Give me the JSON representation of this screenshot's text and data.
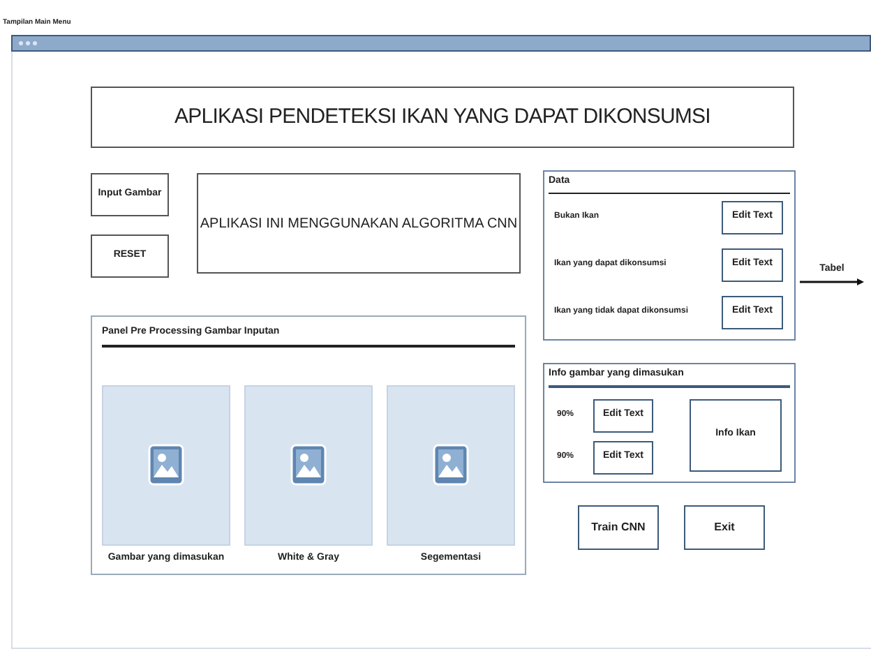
{
  "caption": "Tampilan Main Menu",
  "title": "APLIKASI PENDETEKSI IKAN YANG DAPAT DIKONSUMSI",
  "buttons": [
    "Input Gambar",
    "RESET"
  ],
  "description": "APLIKASI INI MENGGUNAKAN ALGORITMA CNN",
  "preprocessing": {
    "title": "Panel Pre Processing Gambar Inputan",
    "images": [
      {
        "label": "Gambar yang dimasukan"
      },
      {
        "label": "White & Gray"
      },
      {
        "label": "Segementasi"
      }
    ]
  },
  "data_panel": {
    "title": "Data",
    "rows": [
      {
        "label": "Bukan Ikan",
        "field": "Edit Text"
      },
      {
        "label": "Ikan yang dapat dikonsumsi",
        "field": "Edit Text"
      },
      {
        "label": "Ikan yang tidak dapat dikonsumsi",
        "field": "Edit Text"
      }
    ],
    "arrow_label": "Tabel"
  },
  "info_panel": {
    "title": "Info gambar yang dimasukan",
    "rows": [
      {
        "label": "90%",
        "field": "Edit Text"
      },
      {
        "label": "90%",
        "field": "Edit Text"
      }
    ],
    "info": "Info Ikan"
  },
  "actions": [
    "Train CNN",
    "Exit"
  ]
}
